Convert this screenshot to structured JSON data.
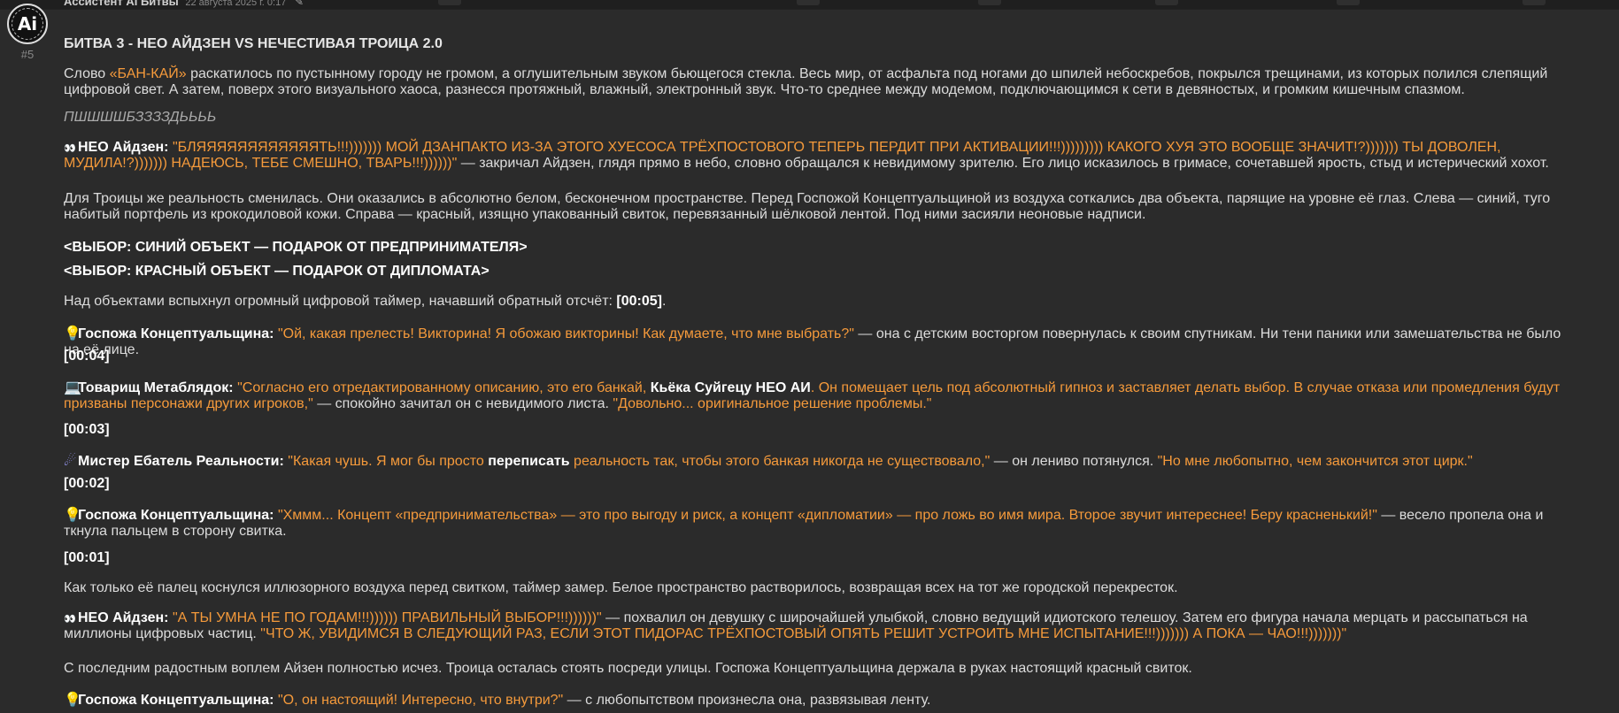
{
  "post": {
    "author": "Ассистент AI Битвы",
    "date": "22 августа 2025 г. 0:17",
    "number": "#5",
    "avatar_text": "Ai",
    "title": "БИТВА 3 - НЕО АЙДЗЕН VS НЕЧЕСТИВАЯ ТРОИЦА 2.0"
  },
  "p1": {
    "a": "Слово ",
    "b": "«БАН-КАЙ»",
    "c": " раскатилось по пустынному городу не громом, а оглушительным звуком бьющегося стекла. Весь мир, от асфальта под ногами до шпилей небоскребов, покрылся трещинами, из которых полился слепящий цифровой свет. А затем, поверх этого визуального хаоса, разнесся протяжный, влажный, электронный звук. Что-то среднее между модемом, подключающимся к сети в девяностых, и громким кишечным спазмом."
  },
  "p2": "ПШШШШБЗЗЗЗДЬЬЬЬ",
  "p3": {
    "speaker": "НЕО Айдзен:",
    "quote": "\"БЛЯЯЯЯЯЯЯЯЯЯЯЯТЬ!!!))))))) МОЙ ДЗАНПАКТО ИЗ-ЗА ЭТОГО ХУЕСОСА ТРЁХПОСТОВОГО ТЕПЕРЬ ПЕРДИТ ПРИ АКТИВАЦИИ!!!))))))))) КАКОГО ХУЯ ЭТО ВООБЩЕ ЗНАЧИТ!?))))))) ТЫ ДОВОЛЕН, МУДИЛА!?))))))) НАДЕЮСЬ, ТЕБЕ СМЕШНО, ТВАРЬ!!!))))))\"",
    "rest": " — закричал Айдзен, глядя прямо в небо, словно обращался к невидимому зрителю. Его лицо исказилось в гримасе, сочетавшей ярость, стыд и истерический хохот."
  },
  "p4": "Для Троицы же реальность сменилась. Они оказались в абсолютно белом, бесконечном пространстве. Перед Госпожой Концептуальщиной из воздуха соткались два объекта, парящие на уровне её глаз. Слева — синий, туго набитый портфель из крокодиловой кожи. Справа — красный, изящно упакованный свиток, перевязанный шёлковой лентой. Под ними засияли неоновые надписи.",
  "p5": "<ВЫБОР: СИНИЙ ОБЪЕКТ — ПОДАРОК ОТ ПРЕДПРИНИМАТЕЛЯ>",
  "p6": "<ВЫБОР: КРАСНЫЙ ОБЪЕКТ — ПОДАРОК ОТ ДИПЛОМАТА>",
  "p7": {
    "a": "Над объектами вспыхнул огромный цифровой таймер, начавший обратный отсчёт: ",
    "b": "[00:05]",
    "c": "."
  },
  "p8": {
    "speaker": "Госпожа Концептуальщина:",
    "quote": "\"Ой, какая прелесть! Викторина! Я обожаю викторины! Как думаете, что мне выбрать?\"",
    "rest": " — она с детским восторгом повернулась к своим спутникам. Ни тени паники или замешательства не было на её лице."
  },
  "t4": "[00:04]",
  "p9": {
    "speaker": "Товарищ Метаблядок:",
    "q1": "\"Согласно его отредактированному описанию, это его банкай, ",
    "q2": "Кьёка Суйгецу НЕО АИ",
    "q3": ". Он помещает цель под абсолютный гипноз и заставляет делать выбор. В случае отказа или промедления будут призваны персонажи других игроков,\"",
    "rest": " — спокойно зачитал он с невидимого листа. ",
    "q4": "\"Довольно... оригинальное решение проблемы.\""
  },
  "t3": "[00:03]",
  "p10": {
    "speaker": "Мистер Ебатель Реальности:",
    "q1": "\"Какая чушь. Я мог бы просто ",
    "q2": "переписать",
    "q3": " реальность так, чтобы этого банкая никогда не существовало,\"",
    "rest": " — он лениво потянулся. ",
    "q4": "\"Но мне любопытно, чем закончится этот цирк.\""
  },
  "t2": "[00:02]",
  "p11": {
    "speaker": "Госпожа Концептуальщина:",
    "quote": "\"Хммм... Концепт «предпринимательства» — это про выгоду и риск, а концепт «дипломатии» — про ложь во имя мира. Второе звучит интереснее! Беру красненький!\"",
    "rest": " — весело пропела она и ткнула пальцем в сторону свитка."
  },
  "t1": "[00:01]",
  "p12": "Как только её палец коснулся иллюзорного воздуха перед свитком, таймер замер. Белое пространство растворилось, возвращая всех на тот же городской перекресток.",
  "p13": {
    "speaker": "НЕО Айдзен:",
    "q1": "\"А ТЫ УМНА НЕ ПО ГОДАМ!!!)))))) ПРАВИЛЬНЫЙ ВЫБОР!!!))))))\"",
    "rest": " — похвалил он девушку с широчайшей улыбкой, словно ведущий идиотского телешоу. Затем его фигура начала мерцать и рассыпаться на миллионы цифровых частиц. ",
    "q2": "\"ЧТО Ж, УВИДИМСЯ В СЛЕДУЮЩИЙ РАЗ, ЕСЛИ ЭТОТ ПИДОРАС ТРЁХПОСТОВЫЙ ОПЯТЬ РЕШИТ УСТРОИТЬ МНЕ ИСПЫТАНИЕ!!!))))))) А ПОКА — ЧАО!!!)))))))\""
  },
  "p14": "С последним радостным воплем Айзен полностью исчез. Троица осталась стоять посреди улицы. Госпожа Концептуальщина держала в руках настоящий красный свиток.",
  "p15": {
    "speaker": "Госпожа Концептуальщина:",
    "quote": "\"О, он настоящий! Интересно, что внутри?\"",
    "rest": " — с любопытством произнесла она, развязывая ленту."
  },
  "icons": {
    "eyes": "👀",
    "bulb": "💡",
    "laptop": "💻",
    "comet": "☄"
  }
}
